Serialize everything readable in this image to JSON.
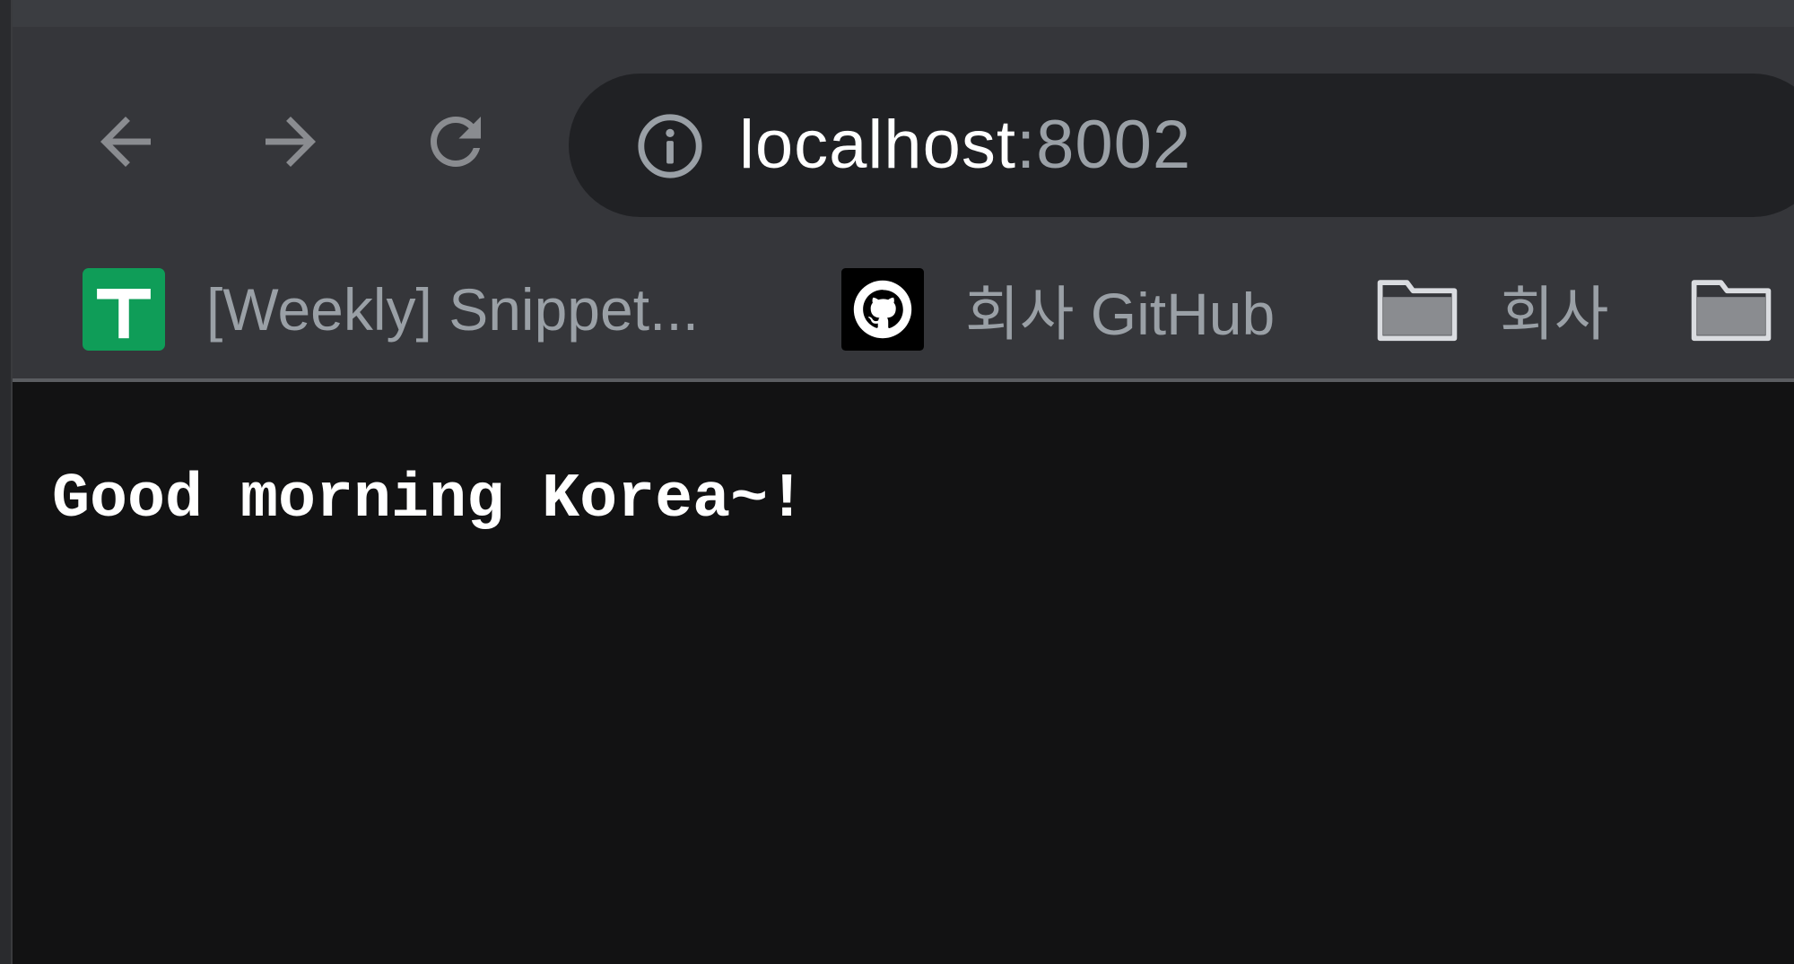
{
  "browser": {
    "address_bar": {
      "host": "localhost",
      "port": ":8002"
    },
    "nav": {
      "back_icon": "arrow-left-icon",
      "forward_icon": "arrow-right-icon",
      "reload_icon": "reload-icon",
      "site_info_icon": "info-icon"
    },
    "bookmarks": [
      {
        "label": "[Weekly] Snippet...",
        "icon": "google-sheets-icon",
        "icon_color": "#0f9d58"
      },
      {
        "label": "회사 GitHub",
        "icon": "github-icon"
      },
      {
        "label": "회사",
        "icon": "folder-icon"
      },
      {
        "label": "",
        "icon": "folder-icon"
      }
    ]
  },
  "page": {
    "text": "Good morning Korea~!"
  },
  "colors": {
    "toolbar_bg": "#35363a",
    "omnibox_bg": "#202124",
    "page_bg": "#121213",
    "muted_text": "#9aa0a6"
  }
}
